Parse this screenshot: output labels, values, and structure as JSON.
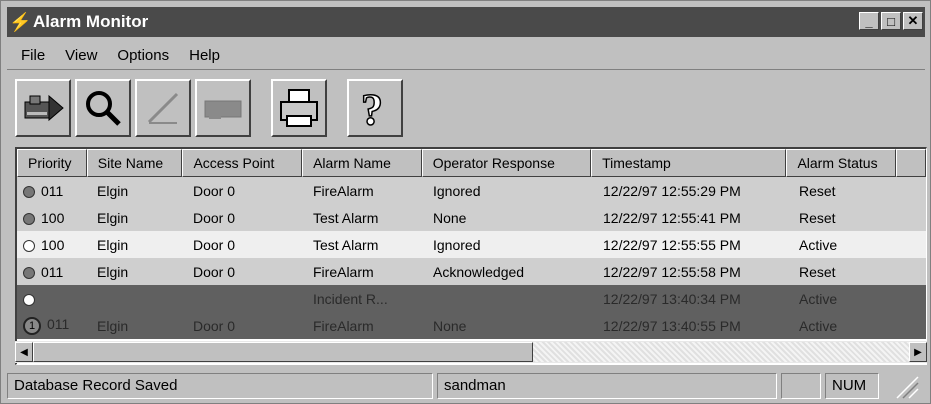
{
  "window": {
    "title": "Alarm Monitor",
    "app_icon": "lightning-icon",
    "controls": [
      "minimize",
      "maximize",
      "close"
    ],
    "control_glyphs": {
      "minimize": "_",
      "maximize": "□",
      "close": "✕"
    }
  },
  "menu": {
    "items": [
      "File",
      "View",
      "Options",
      "Help"
    ]
  },
  "toolbar": {
    "buttons": [
      {
        "icon": "alarm-input-icon"
      },
      {
        "icon": "magnifier-icon"
      },
      {
        "icon": "pencil-icon"
      },
      {
        "icon": "card-icon"
      },
      {
        "icon": "printer-icon"
      },
      {
        "icon": "help-question-icon"
      }
    ]
  },
  "table": {
    "headers": {
      "priority": "Priority",
      "site": "Site Name",
      "access": "Access Point",
      "alarm": "Alarm Name",
      "response": "Operator Response",
      "timestamp": "Timestamp",
      "status": "Alarm Status"
    },
    "rows": [
      {
        "marker": "filled",
        "priority": "011",
        "site": "Elgin",
        "access": "Door 0",
        "alarm": "FireAlarm",
        "response": "Ignored",
        "timestamp": "12/22/97 12:55:29 PM",
        "status": "Reset"
      },
      {
        "marker": "filled",
        "priority": "100",
        "site": "Elgin",
        "access": "Door 0",
        "alarm": "Test Alarm",
        "response": "None",
        "timestamp": "12/22/97 12:55:41 PM",
        "status": "Reset"
      },
      {
        "marker": "hollow",
        "priority": "100",
        "site": "Elgin",
        "access": "Door 0",
        "alarm": "Test Alarm",
        "response": "Ignored",
        "timestamp": "12/22/97 12:55:55 PM",
        "status": "Active"
      },
      {
        "marker": "filled",
        "priority": "011",
        "site": "Elgin",
        "access": "Door 0",
        "alarm": "FireAlarm",
        "response": "Acknowledged",
        "timestamp": "12/22/97 12:55:58 PM",
        "status": "Reset"
      },
      {
        "marker": "hollow",
        "priority": "",
        "site": "",
        "access": "",
        "alarm": "Incident R...",
        "response": "",
        "timestamp": "12/22/97 13:40:34 PM",
        "status": "Active"
      },
      {
        "marker": "numbered",
        "marker_label": "1",
        "priority": "011",
        "site": "Elgin",
        "access": "Door 0",
        "alarm": "FireAlarm",
        "response": "None",
        "timestamp": "12/22/97 13:40:55 PM",
        "status": "Active"
      }
    ]
  },
  "scrollbar": {
    "left_arrow": "◀",
    "right_arrow": "▶"
  },
  "statusbar": {
    "message": "Database Record Saved",
    "user": "sandman",
    "panel3": "",
    "num": "NUM"
  },
  "colors": {
    "titlebar": "#4a4a4a",
    "row_reset": "#cfcfcf",
    "row_active": "#efefef",
    "row_dark": "#606060"
  }
}
